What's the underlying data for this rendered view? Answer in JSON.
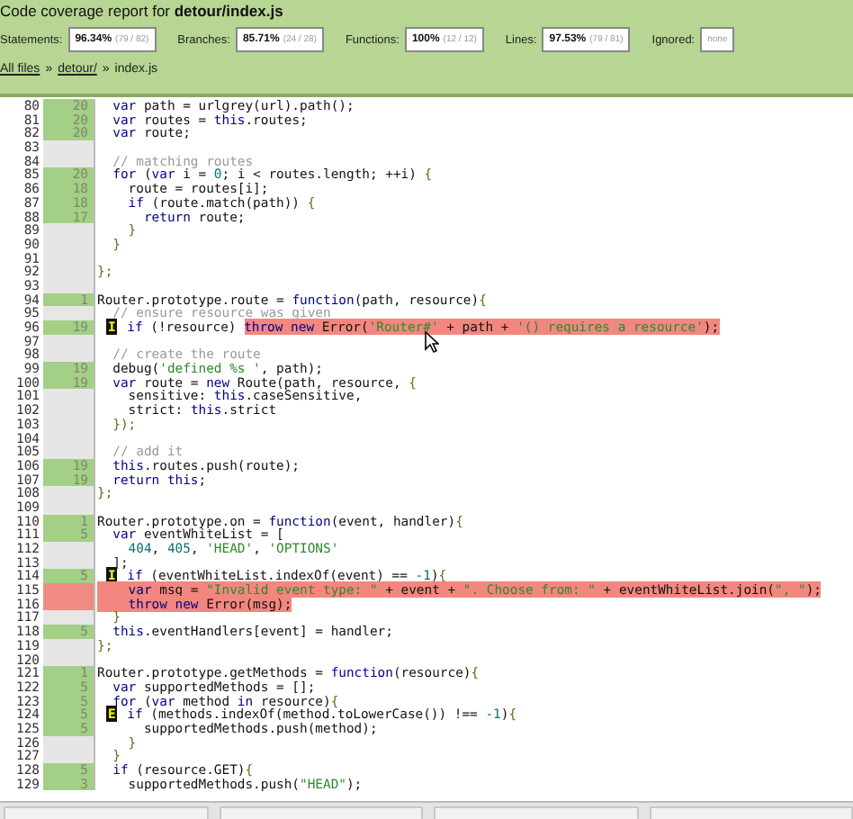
{
  "title": "Code coverage report for **detour/index.js**",
  "stats": [
    {
      "label": "Statements:",
      "pct": "96.34%",
      "fraction": "(79 / 82)"
    },
    {
      "label": "Branches:",
      "pct": "85.71%",
      "fraction": "(24 / 28)"
    },
    {
      "label": "Functions:",
      "pct": "100%",
      "fraction": "(12 / 12)"
    },
    {
      "label": "Lines:",
      "pct": "97.53%",
      "fraction": "(79 / 81)"
    },
    {
      "label": "Ignored:",
      "fraction": "none"
    }
  ],
  "breadcrumb": [
    {
      "text": "All files",
      "link": true
    },
    {
      "text": "»",
      "link": false
    },
    {
      "text": "detour/",
      "link": true
    },
    {
      "text": "»",
      "link": false
    },
    {
      "text": "index.js",
      "link": false
    }
  ],
  "lines": [
    {
      "num": "80",
      "count": "20",
      "kind": "covered",
      "code": [
        {
          "uncovered": false,
          "tokens": [
            {
              "t": "  var",
              "kind": "kw"
            },
            {
              "t": " path = urlgrey(url).path();",
              "kind": "pl"
            }
          ]
        }
      ]
    },
    {
      "num": "81",
      "count": "20",
      "kind": "covered",
      "code": [
        {
          "uncovered": false,
          "tokens": [
            {
              "t": "  var",
              "kind": "kw"
            },
            {
              "t": " routes = ",
              "kind": "pl"
            },
            {
              "t": "this",
              "kind": "kw"
            },
            {
              "t": ".routes;",
              "kind": "pl"
            }
          ]
        }
      ]
    },
    {
      "num": "82",
      "count": "20",
      "kind": "covered",
      "code": [
        {
          "uncovered": false,
          "tokens": [
            {
              "t": "  var",
              "kind": "kw"
            },
            {
              "t": " route;",
              "kind": "pl"
            }
          ]
        }
      ]
    },
    {
      "num": "83",
      "kind": "neutral"
    },
    {
      "num": "84",
      "kind": "neutral",
      "code": [
        {
          "uncovered": false,
          "tokens": [
            {
              "t": "  // matching routes",
              "kind": "com"
            }
          ]
        }
      ]
    },
    {
      "num": "85",
      "count": "20",
      "kind": "covered",
      "code": [
        {
          "uncovered": false,
          "tokens": [
            {
              "t": "  for",
              "kind": "kw"
            },
            {
              "t": " (",
              "kind": "pl"
            },
            {
              "t": "var",
              "kind": "kw"
            },
            {
              "t": " i = ",
              "kind": "pl"
            },
            {
              "t": "0",
              "kind": "num"
            },
            {
              "t": "; i < routes.length; ++i) ",
              "kind": "pl"
            },
            {
              "t": "{",
              "kind": "pun"
            }
          ]
        }
      ]
    },
    {
      "num": "86",
      "count": "18",
      "kind": "covered",
      "code": [
        {
          "uncovered": false,
          "tokens": [
            {
              "t": "    route = routes[i];",
              "kind": "pl"
            }
          ]
        }
      ]
    },
    {
      "num": "87",
      "count": "18",
      "kind": "covered",
      "code": [
        {
          "uncovered": false,
          "tokens": [
            {
              "t": "    if",
              "kind": "kw"
            },
            {
              "t": " (route.match(path)) ",
              "kind": "pl"
            },
            {
              "t": "{",
              "kind": "pun"
            }
          ]
        }
      ]
    },
    {
      "num": "88",
      "count": "17",
      "kind": "covered",
      "code": [
        {
          "uncovered": false,
          "tokens": [
            {
              "t": "      return",
              "kind": "kw"
            },
            {
              "t": " route;",
              "kind": "pl"
            }
          ]
        }
      ]
    },
    {
      "num": "89",
      "kind": "neutral",
      "code": [
        {
          "uncovered": false,
          "tokens": [
            {
              "t": "    }",
              "kind": "pun"
            }
          ]
        }
      ]
    },
    {
      "num": "90",
      "kind": "neutral",
      "code": [
        {
          "uncovered": false,
          "tokens": [
            {
              "t": "  }",
              "kind": "pun"
            }
          ]
        }
      ]
    },
    {
      "num": "91",
      "kind": "neutral"
    },
    {
      "num": "92",
      "kind": "neutral",
      "code": [
        {
          "uncovered": false,
          "tokens": [
            {
              "t": "};",
              "kind": "pun"
            }
          ]
        }
      ]
    },
    {
      "num": "93",
      "kind": "neutral"
    },
    {
      "num": "94",
      "count": "1",
      "kind": "covered",
      "code": [
        {
          "uncovered": false,
          "tokens": [
            {
              "t": "Router.prototype.route = ",
              "kind": "pl"
            },
            {
              "t": "function",
              "kind": "kw"
            },
            {
              "t": "(path, resource)",
              "kind": "pl"
            },
            {
              "t": "{",
              "kind": "pun"
            }
          ]
        }
      ]
    },
    {
      "num": "95",
      "kind": "neutral",
      "code": [
        {
          "uncovered": false,
          "tokens": [
            {
              "t": "  // ensure resource was given",
              "kind": "com"
            }
          ]
        }
      ]
    },
    {
      "num": "96",
      "count": "19",
      "kind": "covered",
      "branch": "I",
      "code": [
        {
          "uncovered": false,
          "tokens": [
            {
              "t": " if",
              "kind": "kw"
            },
            {
              "t": " (!resource) ",
              "kind": "pl"
            }
          ]
        },
        {
          "uncovered": true,
          "tokens": [
            {
              "t": "throw new",
              "kind": "kw"
            },
            {
              "t": " Error(",
              "kind": "pl"
            },
            {
              "t": "'Router#'",
              "kind": "str"
            },
            {
              "t": " + path + ",
              "kind": "pl"
            },
            {
              "t": "'() requires a resource'",
              "kind": "str"
            },
            {
              "t": ");",
              "kind": "pl"
            }
          ]
        }
      ]
    },
    {
      "num": "97",
      "kind": "neutral"
    },
    {
      "num": "98",
      "kind": "neutral",
      "code": [
        {
          "uncovered": false,
          "tokens": [
            {
              "t": "  // create the route",
              "kind": "com"
            }
          ]
        }
      ]
    },
    {
      "num": "99",
      "count": "19",
      "kind": "covered",
      "code": [
        {
          "uncovered": false,
          "tokens": [
            {
              "t": "  debug(",
              "kind": "pl"
            },
            {
              "t": "'defined %s '",
              "kind": "str"
            },
            {
              "t": ", path);",
              "kind": "pl"
            }
          ]
        }
      ]
    },
    {
      "num": "100",
      "count": "19",
      "kind": "covered",
      "code": [
        {
          "uncovered": false,
          "tokens": [
            {
              "t": "  var",
              "kind": "kw"
            },
            {
              "t": " route = ",
              "kind": "pl"
            },
            {
              "t": "new",
              "kind": "kw"
            },
            {
              "t": " Route(path, resource, ",
              "kind": "pl"
            },
            {
              "t": "{",
              "kind": "pun"
            }
          ]
        }
      ]
    },
    {
      "num": "101",
      "kind": "neutral",
      "code": [
        {
          "uncovered": false,
          "tokens": [
            {
              "t": "    sensitive: ",
              "kind": "pl"
            },
            {
              "t": "this",
              "kind": "kw"
            },
            {
              "t": ".caseSensitive,",
              "kind": "pl"
            }
          ]
        }
      ]
    },
    {
      "num": "102",
      "kind": "neutral",
      "code": [
        {
          "uncovered": false,
          "tokens": [
            {
              "t": "    strict: ",
              "kind": "pl"
            },
            {
              "t": "this",
              "kind": "kw"
            },
            {
              "t": ".strict",
              "kind": "pl"
            }
          ]
        }
      ]
    },
    {
      "num": "103",
      "kind": "neutral",
      "code": [
        {
          "uncovered": false,
          "tokens": [
            {
              "t": "  });",
              "kind": "pun"
            }
          ]
        }
      ]
    },
    {
      "num": "104",
      "kind": "neutral"
    },
    {
      "num": "105",
      "kind": "neutral",
      "code": [
        {
          "uncovered": false,
          "tokens": [
            {
              "t": "  // add it",
              "kind": "com"
            }
          ]
        }
      ]
    },
    {
      "num": "106",
      "count": "19",
      "kind": "covered",
      "code": [
        {
          "uncovered": false,
          "tokens": [
            {
              "t": "  this",
              "kind": "kw"
            },
            {
              "t": ".routes.push(route);",
              "kind": "pl"
            }
          ]
        }
      ]
    },
    {
      "num": "107",
      "count": "19",
      "kind": "covered",
      "code": [
        {
          "uncovered": false,
          "tokens": [
            {
              "t": "  return this",
              "kind": "kw"
            },
            {
              "t": ";",
              "kind": "pl"
            }
          ]
        }
      ]
    },
    {
      "num": "108",
      "kind": "neutral",
      "code": [
        {
          "uncovered": false,
          "tokens": [
            {
              "t": "};",
              "kind": "pun"
            }
          ]
        }
      ]
    },
    {
      "num": "109",
      "kind": "neutral"
    },
    {
      "num": "110",
      "count": "1",
      "kind": "covered",
      "code": [
        {
          "uncovered": false,
          "tokens": [
            {
              "t": "Router.prototype.on = ",
              "kind": "pl"
            },
            {
              "t": "function",
              "kind": "kw"
            },
            {
              "t": "(event, handler)",
              "kind": "pl"
            },
            {
              "t": "{",
              "kind": "pun"
            }
          ]
        }
      ]
    },
    {
      "num": "111",
      "count": "5",
      "kind": "covered",
      "code": [
        {
          "uncovered": false,
          "tokens": [
            {
              "t": "  var",
              "kind": "kw"
            },
            {
              "t": " eventWhiteList = [",
              "kind": "pl"
            }
          ]
        }
      ]
    },
    {
      "num": "112",
      "kind": "neutral",
      "code": [
        {
          "uncovered": false,
          "tokens": [
            {
              "t": "    404",
              "kind": "num"
            },
            {
              "t": ", ",
              "kind": "pl"
            },
            {
              "t": "405",
              "kind": "num"
            },
            {
              "t": ", ",
              "kind": "pl"
            },
            {
              "t": "'HEAD'",
              "kind": "str"
            },
            {
              "t": ", ",
              "kind": "pl"
            },
            {
              "t": "'OPTIONS'",
              "kind": "str"
            }
          ]
        }
      ]
    },
    {
      "num": "113",
      "kind": "neutral",
      "code": [
        {
          "uncovered": false,
          "tokens": [
            {
              "t": "  ];",
              "kind": "pl"
            }
          ]
        }
      ]
    },
    {
      "num": "114",
      "count": "5",
      "kind": "covered",
      "branch": "I",
      "code": [
        {
          "uncovered": false,
          "tokens": [
            {
              "t": " if",
              "kind": "kw"
            },
            {
              "t": " (eventWhiteList.indexOf(event) == ",
              "kind": "pl"
            },
            {
              "t": "-1",
              "kind": "num"
            },
            {
              "t": ")",
              "kind": "pl"
            },
            {
              "t": "{",
              "kind": "pun"
            }
          ]
        }
      ]
    },
    {
      "num": "115",
      "kind": "missed",
      "code": [
        {
          "uncovered": true,
          "tokens": [
            {
              "t": "    var",
              "kind": "kw"
            },
            {
              "t": " msg = ",
              "kind": "pl"
            },
            {
              "t": "\"Invalid event type: \"",
              "kind": "str"
            },
            {
              "t": " + event + ",
              "kind": "pl"
            },
            {
              "t": "\". Choose from: \"",
              "kind": "str"
            },
            {
              "t": " + eventWhiteList.join(",
              "kind": "pl"
            },
            {
              "t": "\", \"",
              "kind": "str"
            },
            {
              "t": ");",
              "kind": "pl"
            }
          ]
        }
      ]
    },
    {
      "num": "116",
      "kind": "missed",
      "code": [
        {
          "uncovered": true,
          "tokens": [
            {
              "t": "    throw new",
              "kind": "kw"
            },
            {
              "t": " Error(msg);",
              "kind": "pl"
            }
          ]
        }
      ]
    },
    {
      "num": "117",
      "kind": "neutral",
      "code": [
        {
          "uncovered": false,
          "tokens": [
            {
              "t": "  }",
              "kind": "pun"
            }
          ]
        }
      ]
    },
    {
      "num": "118",
      "count": "5",
      "kind": "covered",
      "code": [
        {
          "uncovered": false,
          "tokens": [
            {
              "t": "  this",
              "kind": "kw"
            },
            {
              "t": ".eventHandlers[event] = handler;",
              "kind": "pl"
            }
          ]
        }
      ]
    },
    {
      "num": "119",
      "kind": "neutral",
      "code": [
        {
          "uncovered": false,
          "tokens": [
            {
              "t": "};",
              "kind": "pun"
            }
          ]
        }
      ]
    },
    {
      "num": "120",
      "kind": "neutral"
    },
    {
      "num": "121",
      "count": "1",
      "kind": "covered",
      "code": [
        {
          "uncovered": false,
          "tokens": [
            {
              "t": "Router.prototype.getMethods = ",
              "kind": "pl"
            },
            {
              "t": "function",
              "kind": "kw"
            },
            {
              "t": "(resource)",
              "kind": "pl"
            },
            {
              "t": "{",
              "kind": "pun"
            }
          ]
        }
      ]
    },
    {
      "num": "122",
      "count": "5",
      "kind": "covered",
      "code": [
        {
          "uncovered": false,
          "tokens": [
            {
              "t": "  var",
              "kind": "kw"
            },
            {
              "t": " supportedMethods = [];",
              "kind": "pl"
            }
          ]
        }
      ]
    },
    {
      "num": "123",
      "count": "5",
      "kind": "covered",
      "code": [
        {
          "uncovered": false,
          "tokens": [
            {
              "t": "  for",
              "kind": "kw"
            },
            {
              "t": " (",
              "kind": "pl"
            },
            {
              "t": "var",
              "kind": "kw"
            },
            {
              "t": " method ",
              "kind": "pl"
            },
            {
              "t": "in",
              "kind": "kw"
            },
            {
              "t": " resource)",
              "kind": "pl"
            },
            {
              "t": "{",
              "kind": "pun"
            }
          ]
        }
      ]
    },
    {
      "num": "124",
      "count": "5",
      "kind": "covered",
      "branch": "E",
      "code": [
        {
          "uncovered": false,
          "tokens": [
            {
              "t": " if",
              "kind": "kw"
            },
            {
              "t": " (methods.indexOf(method.toLowerCase()) !== ",
              "kind": "pl"
            },
            {
              "t": "-1",
              "kind": "num"
            },
            {
              "t": ")",
              "kind": "pl"
            },
            {
              "t": "{",
              "kind": "pun"
            }
          ]
        }
      ]
    },
    {
      "num": "125",
      "count": "5",
      "kind": "covered",
      "code": [
        {
          "uncovered": false,
          "tokens": [
            {
              "t": "      supportedMethods.push(method);",
              "kind": "pl"
            }
          ]
        }
      ]
    },
    {
      "num": "126",
      "kind": "neutral",
      "code": [
        {
          "uncovered": false,
          "tokens": [
            {
              "t": "    }",
              "kind": "pun"
            }
          ]
        }
      ]
    },
    {
      "num": "127",
      "kind": "neutral",
      "code": [
        {
          "uncovered": false,
          "tokens": [
            {
              "t": "  }",
              "kind": "pun"
            }
          ]
        }
      ]
    },
    {
      "num": "128",
      "count": "5",
      "kind": "covered",
      "code": [
        {
          "uncovered": false,
          "tokens": [
            {
              "t": "  if",
              "kind": "kw"
            },
            {
              "t": " (resource.GET)",
              "kind": "pl"
            },
            {
              "t": "{",
              "kind": "pun"
            }
          ]
        }
      ]
    },
    {
      "num": "129",
      "count": "3",
      "kind": "covered",
      "code": [
        {
          "uncovered": false,
          "tokens": [
            {
              "t": "    supportedMethods.push(",
              "kind": "pl"
            },
            {
              "t": "\"HEAD\"",
              "kind": "str"
            },
            {
              "t": ");",
              "kind": "pl"
            }
          ]
        }
      ]
    }
  ]
}
